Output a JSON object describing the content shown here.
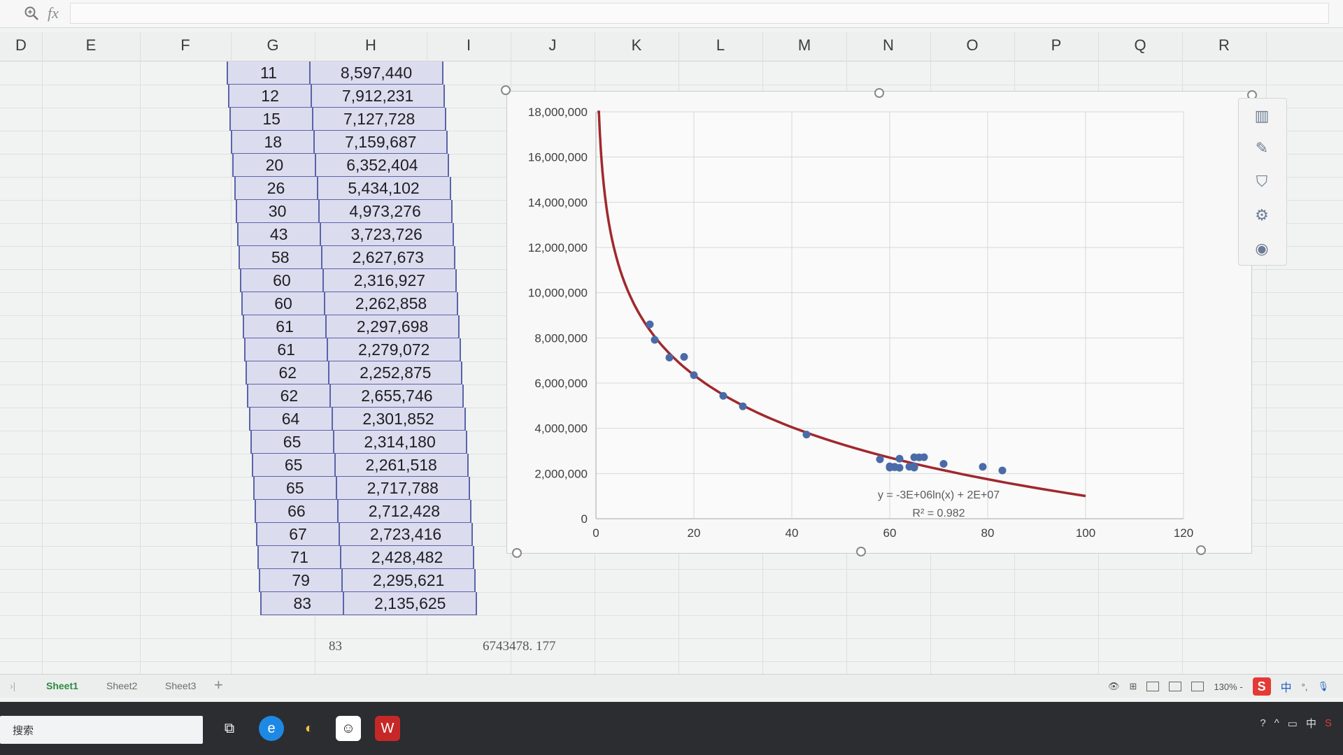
{
  "formula_bar": {
    "fx_label": "fx",
    "value": ""
  },
  "columns": [
    "D",
    "E",
    "F",
    "G",
    "H",
    "I",
    "J",
    "K",
    "L",
    "M",
    "N",
    "O",
    "P",
    "Q",
    "R"
  ],
  "table": {
    "rows": [
      {
        "g": "11",
        "h": "8,597,440"
      },
      {
        "g": "12",
        "h": "7,912,231"
      },
      {
        "g": "15",
        "h": "7,127,728"
      },
      {
        "g": "18",
        "h": "7,159,687"
      },
      {
        "g": "20",
        "h": "6,352,404"
      },
      {
        "g": "26",
        "h": "5,434,102"
      },
      {
        "g": "30",
        "h": "4,973,276"
      },
      {
        "g": "43",
        "h": "3,723,726"
      },
      {
        "g": "58",
        "h": "2,627,673"
      },
      {
        "g": "60",
        "h": "2,316,927"
      },
      {
        "g": "60",
        "h": "2,262,858"
      },
      {
        "g": "61",
        "h": "2,297,698"
      },
      {
        "g": "61",
        "h": "2,279,072"
      },
      {
        "g": "62",
        "h": "2,252,875"
      },
      {
        "g": "62",
        "h": "2,655,746"
      },
      {
        "g": "64",
        "h": "2,301,852"
      },
      {
        "g": "65",
        "h": "2,314,180"
      },
      {
        "g": "65",
        "h": "2,261,518"
      },
      {
        "g": "65",
        "h": "2,717,788"
      },
      {
        "g": "66",
        "h": "2,712,428"
      },
      {
        "g": "67",
        "h": "2,723,416"
      },
      {
        "g": "71",
        "h": "2,428,482"
      },
      {
        "g": "79",
        "h": "2,295,621"
      },
      {
        "g": "83",
        "h": "2,135,625"
      }
    ],
    "footer_g": "83",
    "footer_i": "6743478. 177"
  },
  "chart_data": {
    "type": "scatter",
    "x": [
      11,
      12,
      15,
      18,
      20,
      26,
      30,
      43,
      58,
      60,
      60,
      61,
      61,
      62,
      62,
      64,
      65,
      65,
      65,
      66,
      67,
      71,
      79,
      83
    ],
    "y": [
      8597440,
      7912231,
      7127728,
      7159687,
      6352404,
      5434102,
      4973276,
      3723726,
      2627673,
      2316927,
      2262858,
      2297698,
      2279072,
      2252875,
      2655746,
      2301852,
      2314180,
      2261518,
      2717788,
      2712428,
      2723416,
      2428482,
      2295621,
      2135625
    ],
    "xlim": [
      0,
      120
    ],
    "ylim": [
      0,
      18000000
    ],
    "x_ticks": [
      "0",
      "20",
      "40",
      "60",
      "80",
      "100",
      "120"
    ],
    "y_ticks": [
      "0",
      "2,000,000",
      "4,000,000",
      "6,000,000",
      "8,000,000",
      "10,000,000",
      "12,000,000",
      "14,000,000",
      "16,000,000",
      "18,000,000"
    ],
    "trendline": {
      "type": "log",
      "equation": "y = -3E+06ln(x) + 2E+07",
      "r2": "R² = 0.982",
      "x_range": [
        0.3,
        100
      ]
    },
    "grid": true,
    "point_color": "#4a6aa8",
    "trend_color": "#a0282d"
  },
  "sheets": {
    "tabs": [
      "Sheet1",
      "Sheet2",
      "Sheet3"
    ],
    "active": "Sheet1",
    "add": "+"
  },
  "status": {
    "zoom": "130% -",
    "ime": "中"
  },
  "taskbar": {
    "search_label": "搜索"
  }
}
